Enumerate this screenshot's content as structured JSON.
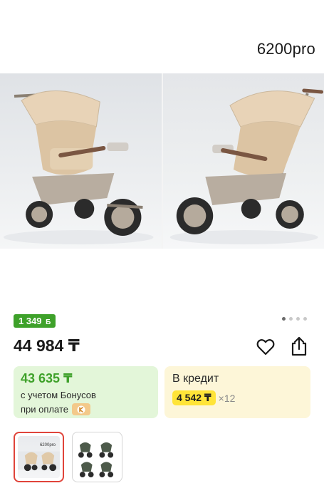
{
  "product": {
    "model_label": "6200pro",
    "image_dots": {
      "total": 4,
      "active_index": 0
    }
  },
  "bonus_badge": {
    "amount": "1 349",
    "symbol": "Б"
  },
  "price": {
    "main": "44 984 ₸"
  },
  "actions": {
    "favorite_icon": "heart-icon",
    "share_icon": "share-icon"
  },
  "bonus_offer": {
    "price": "43 635 ₸",
    "desc_line1": "с учетом Бонусов",
    "desc_line2": "при оплате"
  },
  "credit_offer": {
    "title": "В кредит",
    "monthly": "4 542 ₸",
    "months": "×12"
  },
  "thumbnails": [
    {
      "label": "6200pro",
      "selected": true,
      "color": "#e0443a"
    },
    {
      "label": "",
      "selected": false
    }
  ],
  "colors": {
    "accent_green": "#3ea12a",
    "credit_yellow": "#ffe438",
    "selected_border": "#e0443a"
  }
}
